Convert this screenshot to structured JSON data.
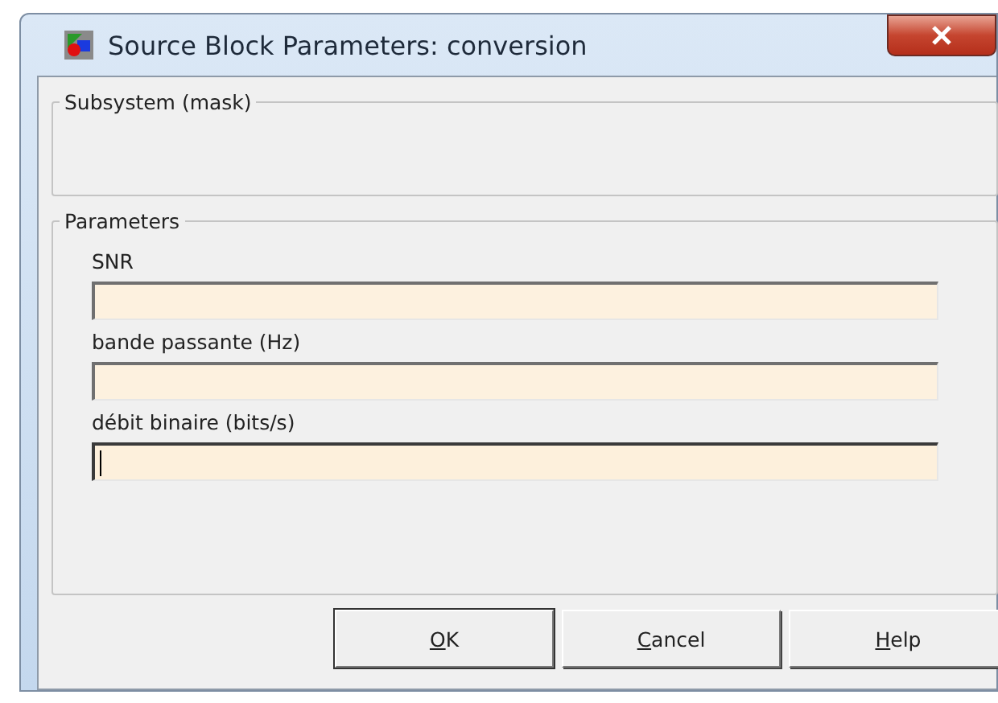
{
  "window": {
    "title": "Source Block Parameters: conversion"
  },
  "subsystem_group": {
    "title": "Subsystem (mask)"
  },
  "parameters_group": {
    "title": "Parameters",
    "fields": [
      {
        "label": "SNR",
        "focused": false
      },
      {
        "label": "bande passante (Hz)",
        "focused": false
      },
      {
        "label": "débit binaire (bits/s)",
        "focused": true
      }
    ]
  },
  "buttons": [
    {
      "label": "OK",
      "default": true
    },
    {
      "label": "Cancel",
      "default": false
    },
    {
      "label": "Help",
      "default": false
    }
  ]
}
